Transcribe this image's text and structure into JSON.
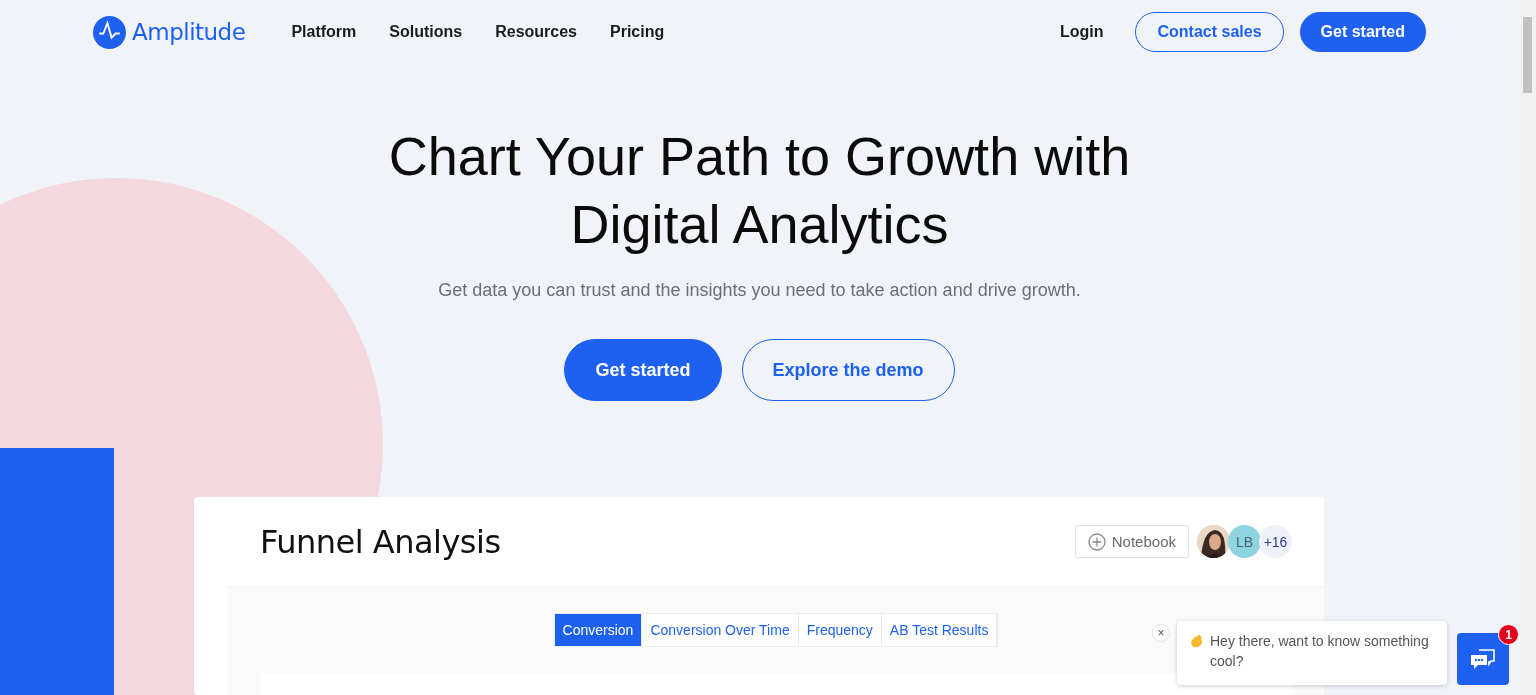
{
  "nav": {
    "brand": "Amplitude",
    "links": [
      "Platform",
      "Solutions",
      "Resources",
      "Pricing"
    ],
    "login": "Login",
    "contact": "Contact sales",
    "cta": "Get started"
  },
  "hero": {
    "title_lines": [
      "Chart Your Path to Growth with",
      "Digital Analytics"
    ],
    "subtitle": "Get data you can trust and the insights you need to take action and drive growth.",
    "primary": "Get started",
    "secondary": "Explore the demo"
  },
  "card": {
    "title": "Funnel Analysis",
    "notebook": "Notebook",
    "avatars": [
      {
        "kind": "picture"
      },
      {
        "kind": "initials",
        "text": "LB"
      },
      {
        "kind": "count",
        "text": "+16"
      }
    ],
    "tabs": [
      {
        "label": "Conversion",
        "selected": true
      },
      {
        "label": "Conversion Over Time",
        "selected": false
      },
      {
        "label": "Frequency",
        "selected": false
      },
      {
        "label": "AB Test Results",
        "selected": false
      }
    ]
  },
  "chat": {
    "close": "×",
    "message": "Hey there, want to know something cool?",
    "badge": "1"
  }
}
